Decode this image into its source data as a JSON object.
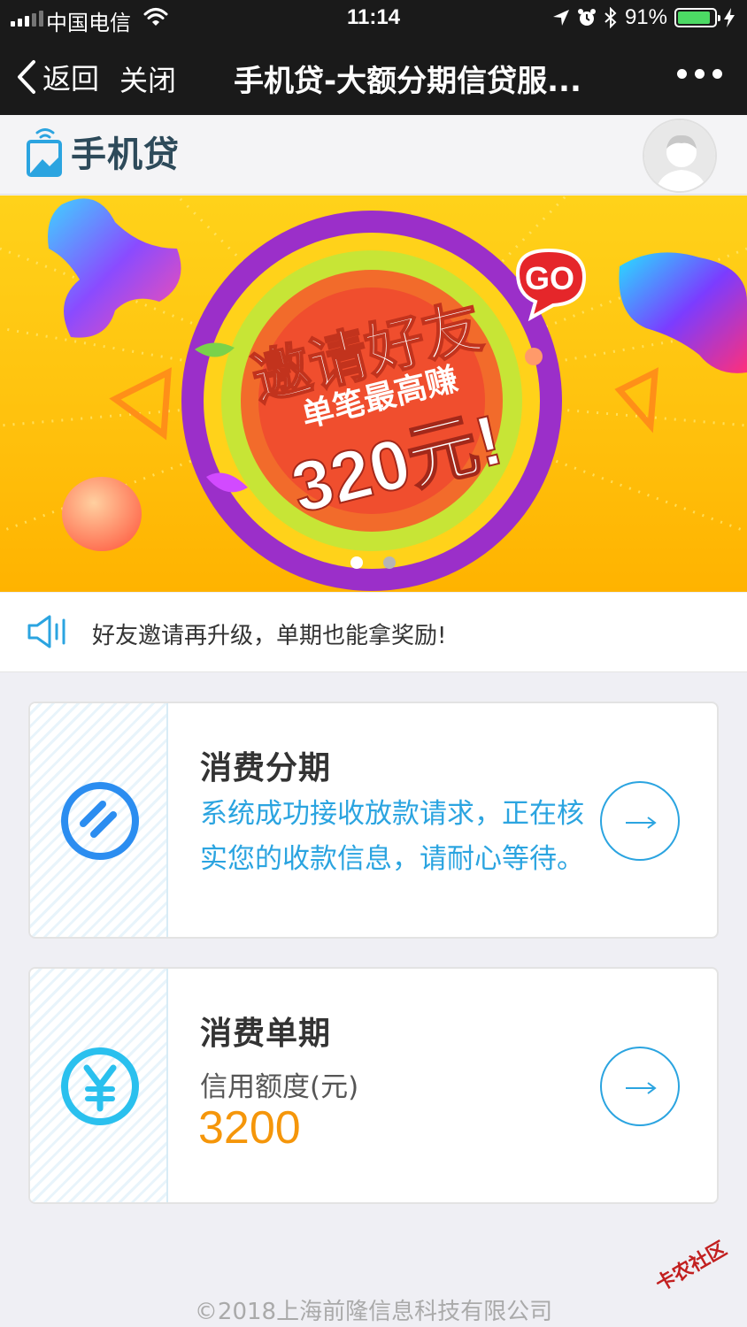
{
  "status_bar": {
    "carrier": "中国电信",
    "time": "11:14",
    "battery_percent": "91%",
    "battery_level": 0.91,
    "icons": [
      "signal-icon",
      "wifi-icon",
      "location-icon",
      "alarm-icon",
      "bluetooth-icon",
      "battery-icon",
      "charging-icon"
    ]
  },
  "nav": {
    "back_label": "返回",
    "close_label": "关闭",
    "title": "手机贷-大额分期信贷服...",
    "more_icon": "more-icon"
  },
  "header": {
    "logo_text": "手机贷",
    "avatar_icon": "user-avatar-icon"
  },
  "banner": {
    "line1": "邀请好友",
    "line2": "单笔最高赚",
    "line3": "320元!",
    "go_badge": "GO",
    "slide_count": 2,
    "active_slide": 1
  },
  "notice": {
    "icon": "speaker-icon",
    "text": "好友邀请再升级，单期也能拿奖励!"
  },
  "cards": [
    {
      "title": "消费分期",
      "description": "系统成功接收放款请求，正在核实您的收款信息，请耐心等待。",
      "icon": "installment-icon",
      "action_icon": "arrow-right-icon"
    },
    {
      "title": "消费单期",
      "label": "信用额度(元)",
      "amount": "3200",
      "icon": "yuan-icon",
      "action_icon": "arrow-right-icon"
    }
  ],
  "footer": {
    "copyright": "©2018上海前隆信息科技有限公司"
  },
  "watermark": "卡农社区",
  "colors": {
    "accent_blue": "#2ba4e0",
    "amount_orange": "#f5960a",
    "nav_bg": "#1a1a1a",
    "page_bg": "#efeff4"
  }
}
